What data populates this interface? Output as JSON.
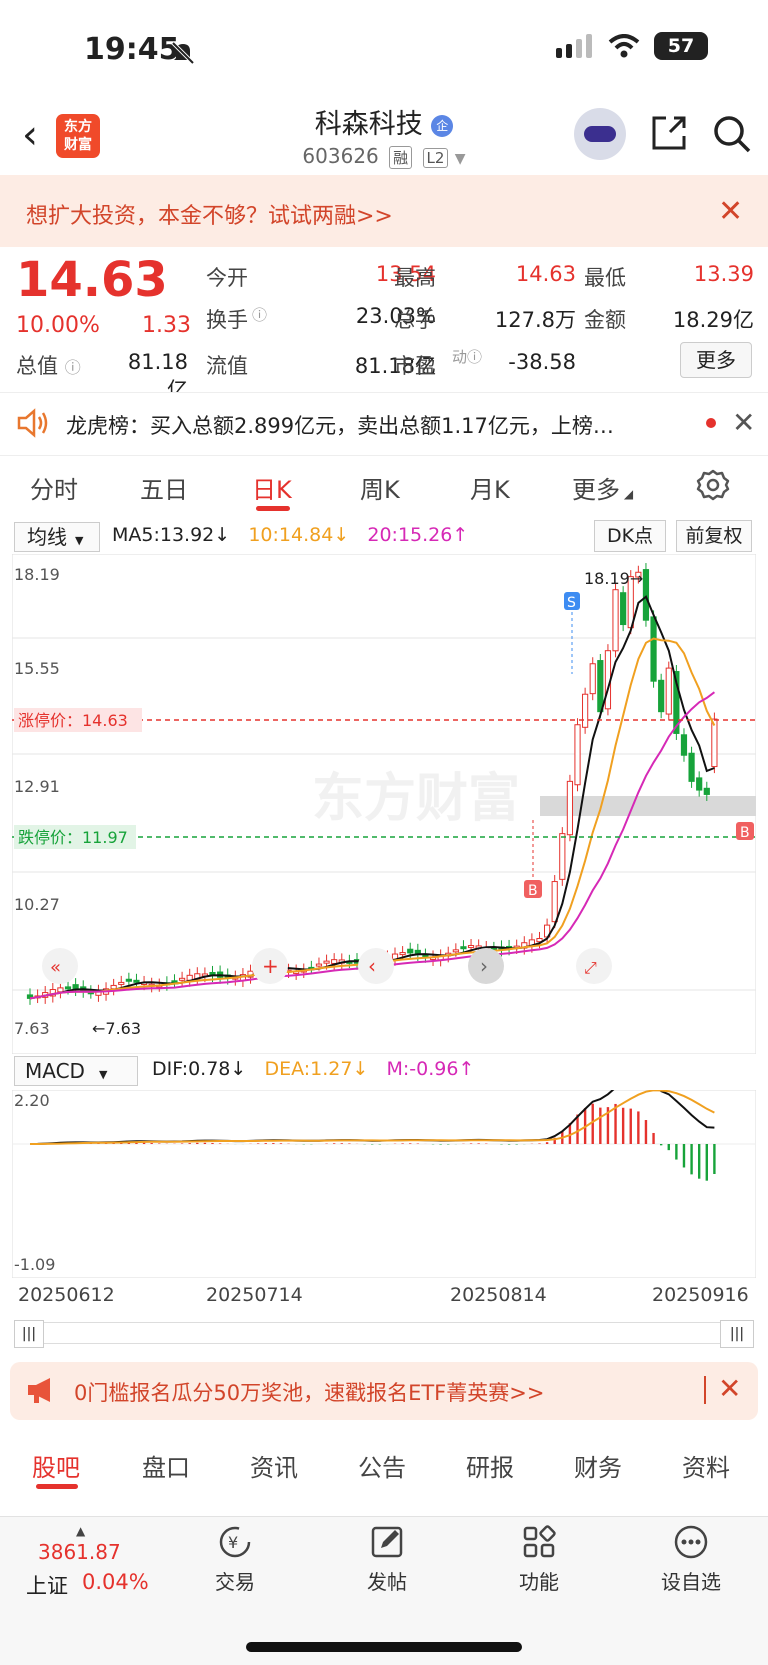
{
  "status_bar": {
    "time": "19:45",
    "battery": "57"
  },
  "header": {
    "logo": [
      "东方",
      "财富"
    ],
    "name": "科森科技",
    "badge": "企",
    "code": "603626",
    "tags": [
      "融",
      "L2"
    ]
  },
  "promo": {
    "text": "想扩大投资，本金不够？试试两融>>",
    "close": "✕"
  },
  "quote": {
    "price": "14.63",
    "pct": "10.00%",
    "change": "1.33",
    "total_cap_label": "总值",
    "total_cap": "81.18亿",
    "fields": [
      {
        "label": "今开",
        "value": "13.54",
        "color": "#e5322d"
      },
      {
        "label": "最高",
        "value": "14.63",
        "color": "#e5322d"
      },
      {
        "label": "最低",
        "value": "13.39",
        "color": "#e5322d"
      },
      {
        "label": "换手",
        "value": "23.03%",
        "color": "#222"
      },
      {
        "label": "总手",
        "value": "127.8万",
        "color": "#222"
      },
      {
        "label": "金额",
        "value": "18.29亿",
        "color": "#222"
      },
      {
        "label": "流值",
        "value": "81.18亿",
        "color": "#222"
      },
      {
        "label": "市盈",
        "value": "-38.58",
        "color": "#222"
      }
    ],
    "more": "更多"
  },
  "ticker": {
    "text": "龙虎榜：买入总额2.899亿元，卖出总额1.17亿元，上榜…"
  },
  "tabs": [
    "分时",
    "五日",
    "日K",
    "周K",
    "月K",
    "更多"
  ],
  "ma_bar": {
    "select": "均线",
    "ma5": "MA5:13.92",
    "ma10": "10:14.84",
    "ma20": "20:15.26",
    "dk": "DK点",
    "fq": "前复权"
  },
  "kline": {
    "axis_labels": [
      "18.19",
      "15.55",
      "12.91",
      "10.27",
      "7.63"
    ],
    "limit_up_label": "涨停价：14.63",
    "limit_down_label": "跌停价：11.97",
    "high_marker": "18.19",
    "low_marker": "7.63",
    "watermark": "东方财富",
    "sell_mark": "S",
    "buy_mark": "B"
  },
  "macd_bar": {
    "select": "MACD",
    "dif": "DIF:0.78",
    "dea": "DEA:1.27",
    "m": "M:-0.96"
  },
  "macd": {
    "top": "2.20",
    "bottom": "-1.09"
  },
  "dates": [
    "20250612",
    "20250714",
    "20250814",
    "20250916"
  ],
  "ad": {
    "text": "0门槛报名瓜分50万奖池，速戳报名ETF菁英赛>>",
    "close": "✕"
  },
  "sub_tabs": [
    "股吧",
    "盘口",
    "资讯",
    "公告",
    "研报",
    "财务",
    "资料"
  ],
  "bottom_nav": {
    "index_value": "3861.87",
    "index_name": "上证",
    "index_pct": "0.04%",
    "items": [
      "交易",
      "发帖",
      "功能",
      "设自选"
    ]
  },
  "colors": {
    "up": "#e5322d",
    "down": "#17a33a",
    "ma10": "#f0a020",
    "ma20": "#d629b6"
  }
}
